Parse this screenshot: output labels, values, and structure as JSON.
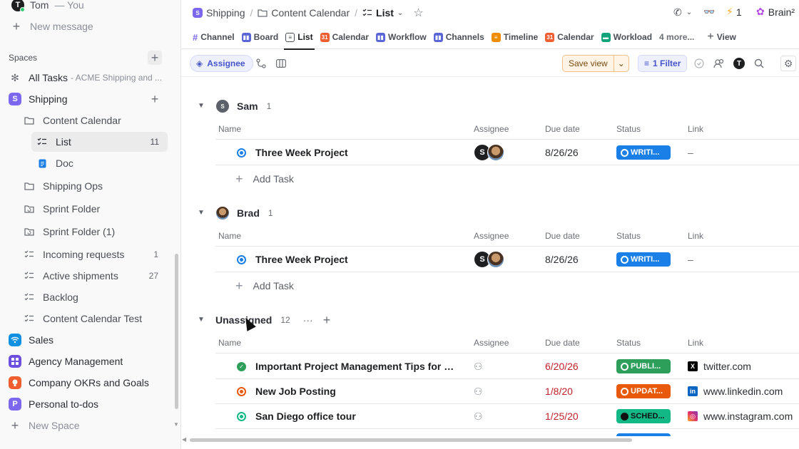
{
  "colors": {
    "accent": "#4656c9",
    "shipping": "#7b68ee",
    "sales": "#1090e0",
    "agency": "#6c4fe0",
    "okrs": "#ee5e31",
    "personal": "#7b68ee",
    "published": "#2e9e5b",
    "update": "#e8590c",
    "scheduled": "#12b886",
    "writing": "#1a7fe6"
  },
  "sidebar": {
    "user_name": "Tom",
    "user_suffix": "— You",
    "user_initial": "T",
    "new_message": "New message",
    "spaces_label": "Spaces",
    "all_tasks": "All Tasks",
    "all_tasks_sub": "- ACME Shipping and ...",
    "shipping": {
      "badge": "S",
      "name": "Shipping"
    },
    "content_calendar": "Content Calendar",
    "list": {
      "name": "List",
      "count": "11"
    },
    "doc": "Doc",
    "shipping_ops": "Shipping Ops",
    "sprint_folder": "Sprint Folder",
    "sprint_folder_1": "Sprint Folder (1)",
    "incoming": {
      "name": "Incoming requests",
      "count": "1"
    },
    "active": {
      "name": "Active shipments",
      "count": "27"
    },
    "backlog": "Backlog",
    "cc_test": "Content Calendar Test",
    "sales": "Sales",
    "agency": "Agency Management",
    "okrs": "Company OKRs and Goals",
    "personal": {
      "badge": "P",
      "name": "Personal to-dos"
    },
    "new_space": "New Space"
  },
  "header": {
    "crumb_space_badge": "S",
    "crumb_space": "Shipping",
    "crumb_folder": "Content Calendar",
    "crumb_list": "List",
    "lightning_count": "1",
    "brain": "Brain²"
  },
  "tabs": {
    "channel": "Channel",
    "board": "Board",
    "list": "List",
    "calendar": "Calendar",
    "workflow": "Workflow",
    "channels": "Channels",
    "timeline": "Timeline",
    "calendar2": "Calendar",
    "workload": "Workload",
    "more": "4 more...",
    "view": "View",
    "cal_num": "31"
  },
  "toolbar": {
    "assignee": "Assignee",
    "save_view": "Save view",
    "filter": "1 Filter",
    "avatar_initial": "T"
  },
  "columns": {
    "name": "Name",
    "assignee": "Assignee",
    "due": "Due date",
    "status": "Status",
    "link": "Link"
  },
  "groups": {
    "sam": {
      "initial": "S",
      "name": "Sam",
      "count": "1",
      "task": {
        "name": "Three Week Project",
        "assignee_initial": "S",
        "due": "8/26/26",
        "status": "WRITI...",
        "link": "–"
      }
    },
    "brad": {
      "name": "Brad",
      "count": "1",
      "task": {
        "name": "Three Week Project",
        "assignee_initial": "S",
        "due": "8/26/26",
        "status": "WRITI...",
        "link": "–"
      }
    },
    "unassigned": {
      "name": "Unassigned",
      "count": "12",
      "tasks": [
        {
          "name": "Important Project Management Tips for Stu...",
          "due": "6/20/26",
          "status": "PUBLI...",
          "link": "twitter.com",
          "link_icon": "x-icon"
        },
        {
          "name": "New Job Posting",
          "due": "1/8/20",
          "status": "UPDAT...",
          "link": "www.linkedin.com",
          "link_icon": "linkedin-icon"
        },
        {
          "name": "San Diego office tour",
          "due": "1/25/20",
          "status": "SCHED...",
          "link": "www.instagram.com",
          "link_icon": "instagram-icon"
        }
      ]
    }
  },
  "add_task": "Add Task"
}
